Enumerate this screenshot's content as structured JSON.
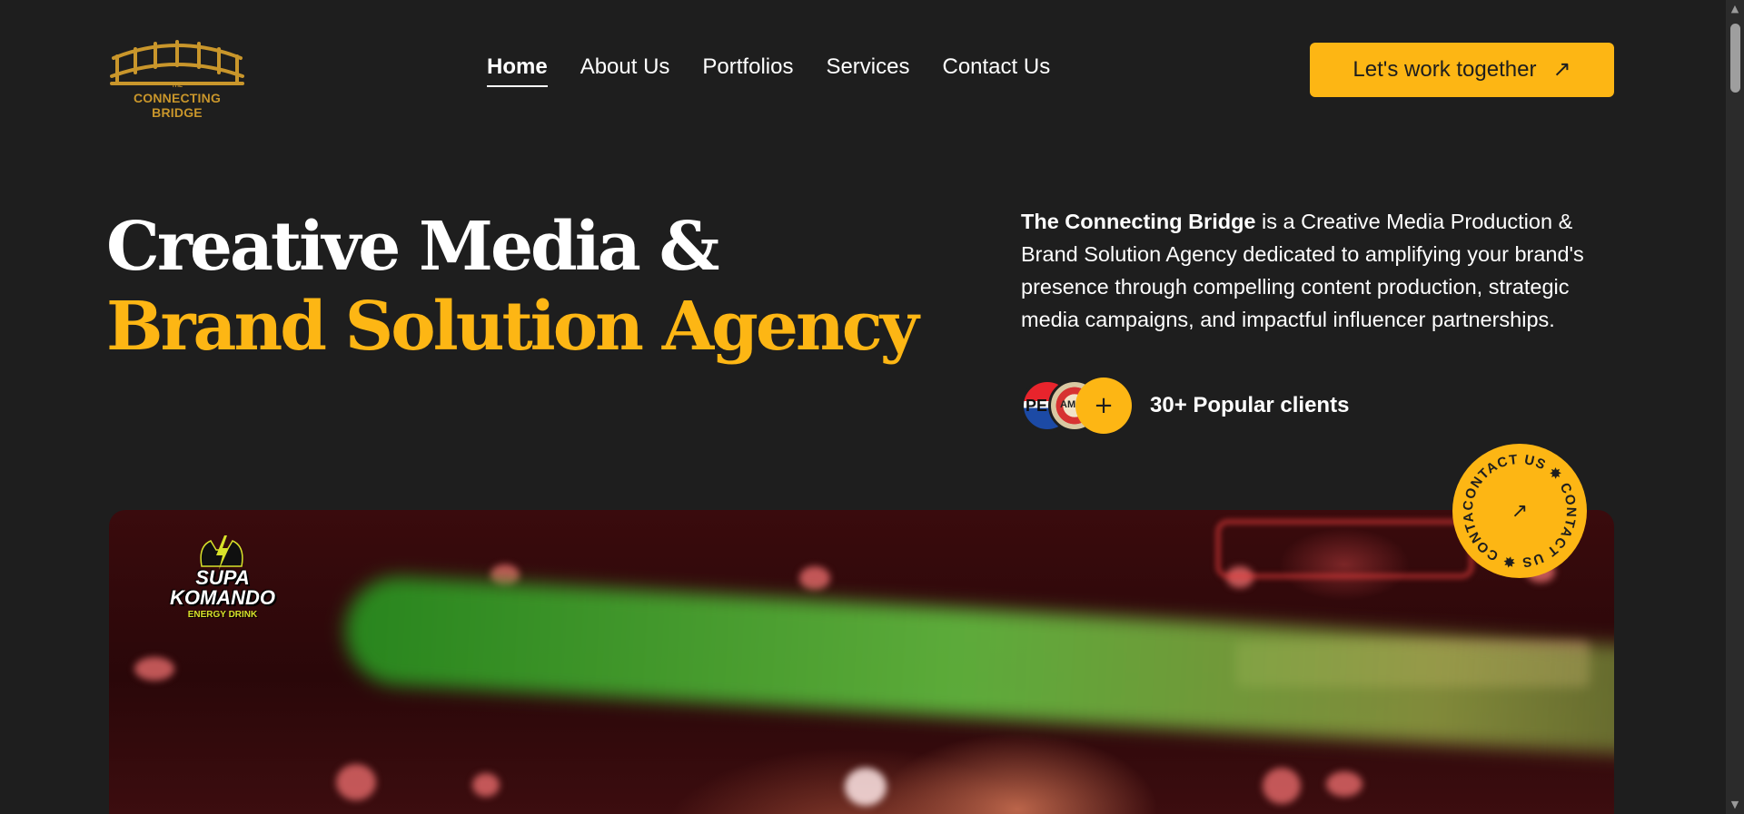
{
  "header": {
    "logo": {
      "small_text": "THE",
      "name": "CONNECTING BRIDGE",
      "color": "#c9962b"
    },
    "nav": [
      {
        "label": "Home",
        "active": true
      },
      {
        "label": "About Us",
        "active": false
      },
      {
        "label": "Portfolios",
        "active": false
      },
      {
        "label": "Services",
        "active": false
      },
      {
        "label": "Contact Us",
        "active": false
      }
    ],
    "cta": {
      "label": "Let's work together",
      "icon": "arrow-up-right-icon"
    }
  },
  "hero": {
    "title_line1": "Creative Media &",
    "title_line2": "Brand Solution Agency",
    "description_bold": "The Connecting Bridge",
    "description_rest": " is a Creative Media Production & Brand Solution Agency dedicated to amplifying your brand's presence through compelling content production, strategic media campaigns, and impactful influencer partnerships.",
    "clients": {
      "avatar1_text": "PE",
      "avatar2_text": "AM",
      "plus_symbol": "+",
      "label": "30+ Popular clients"
    }
  },
  "contact_badge": {
    "text": "CONTACT US ✸ CONTACT US ✸ CONTACT US ✸",
    "icon": "arrow-up-right-icon"
  },
  "showcase": {
    "brand_name_line1": "SUPA",
    "brand_name_line2": "KOMANDO",
    "brand_sub": "ENERGY DRINK"
  },
  "colors": {
    "accent": "#fdb614",
    "background": "#1e1e1e",
    "text": "#ffffff"
  }
}
